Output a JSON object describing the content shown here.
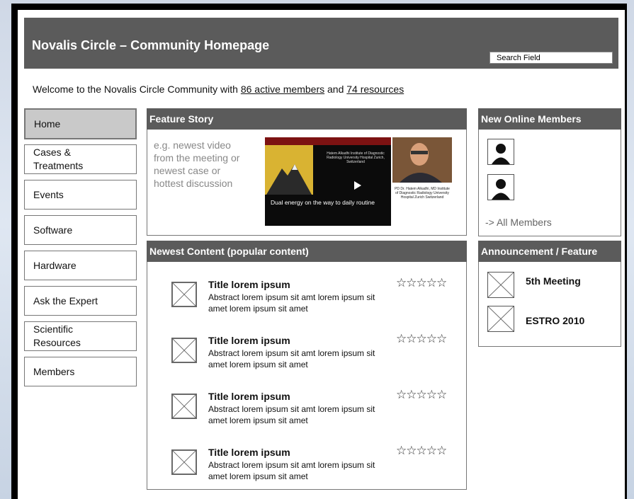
{
  "header": {
    "title": "Novalis Circle – Community Homepage",
    "search_placeholder": "Search Field"
  },
  "welcome": {
    "prefix": "Welcome to the Novalis Circle Community with ",
    "members_link": "86 active members",
    "middle": " and ",
    "resources_link": "74 resources"
  },
  "nav": {
    "items": [
      {
        "label": "Home"
      },
      {
        "label": "Cases & Treatments"
      },
      {
        "label": "Events"
      },
      {
        "label": "Software"
      },
      {
        "label": "Hardware"
      },
      {
        "label": "Ask the Expert"
      },
      {
        "label": "Scientific Resources"
      },
      {
        "label": "Members"
      }
    ]
  },
  "feature": {
    "heading": "Feature Story",
    "text": "e.g. newest video from the meeting or newest case or hottest discussion",
    "video_caption": "Dual energy on the way to daily routine",
    "video_small_text": "Hatem Alkadhi Institute of Diagnostic Radiology University Hospital Zurich, Switzerland",
    "portrait_text": "PD Dr. Hatem Alkadhi, MD Institute of Diagnostic Radiology University Hospital Zurich Switzerland"
  },
  "newest": {
    "heading": "Newest Content  (popular content)",
    "items": [
      {
        "title": "Title lorem ipsum",
        "abstract": "Abstract lorem ipsum sit amt lorem ipsum sit amet lorem ipsum sit amet",
        "stars": "☆☆☆☆☆"
      },
      {
        "title": "Title lorem ipsum",
        "abstract": "Abstract lorem ipsum sit amt lorem ipsum sit amet lorem ipsum sit amet",
        "stars": "☆☆☆☆☆"
      },
      {
        "title": "Title lorem ipsum",
        "abstract": "Abstract lorem ipsum sit amt lorem ipsum sit amet lorem ipsum sit amet",
        "stars": "☆☆☆☆☆"
      },
      {
        "title": "Title lorem ipsum",
        "abstract": "Abstract lorem ipsum sit amt lorem ipsum sit amet lorem ipsum sit amet",
        "stars": "☆☆☆☆☆"
      }
    ]
  },
  "online_members": {
    "heading": "New Online Members",
    "all_link": "-> All Members"
  },
  "announcement": {
    "heading": "Announcement / Feature",
    "items": [
      {
        "label": "5th Meeting"
      },
      {
        "label": "ESTRO 2010"
      }
    ]
  },
  "colors": {
    "header_bg": "#5b5b5b",
    "active_nav_bg": "#c9c9c9",
    "panel_border": "#777777"
  }
}
